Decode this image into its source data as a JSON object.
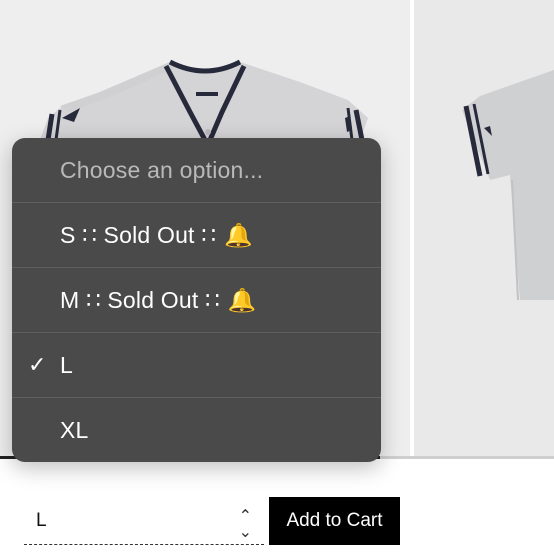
{
  "product_gallery": {
    "images": [
      {
        "alt": "jersey-front"
      },
      {
        "alt": "jersey-side"
      }
    ]
  },
  "size_dropdown": {
    "placeholder": "Choose an option...",
    "options": [
      {
        "label": "S ∷ Sold Out ∷",
        "icon": "bell-icon",
        "selected": false
      },
      {
        "label": "M ∷ Sold Out ∷",
        "icon": "bell-icon",
        "selected": false
      },
      {
        "label": "L",
        "selected": true
      },
      {
        "label": "XL",
        "selected": false
      }
    ]
  },
  "variation_select": {
    "value": "L",
    "icon": "up-down-chevron-icon"
  },
  "add_to_cart": {
    "label": "Add to Cart"
  }
}
